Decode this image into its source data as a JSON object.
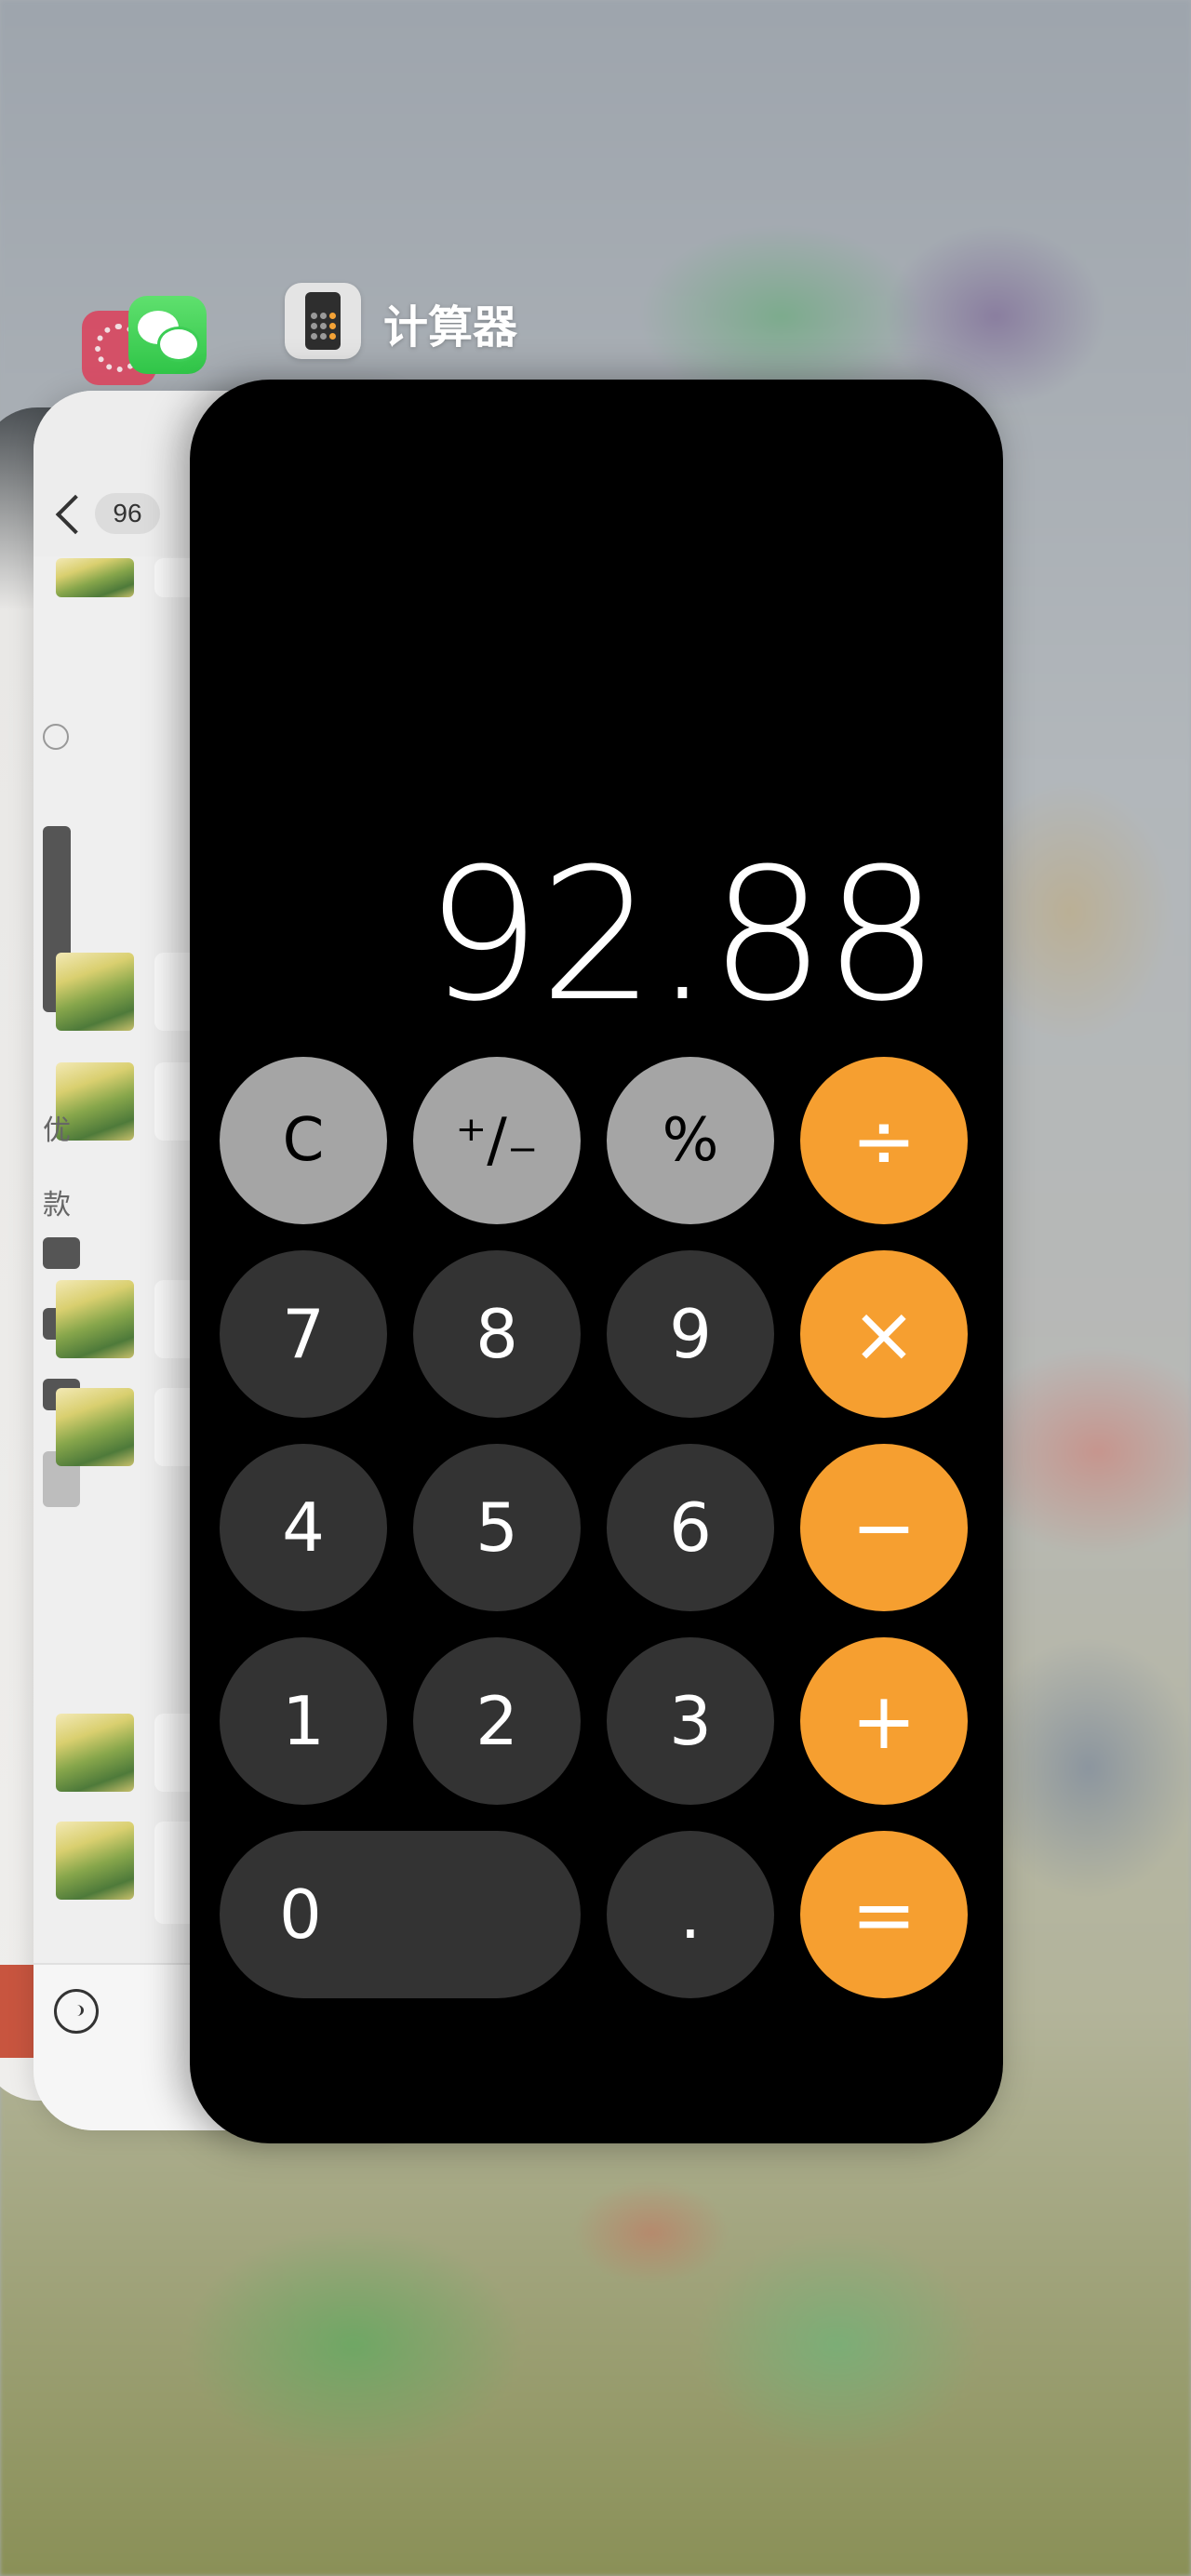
{
  "app_switcher": {
    "active_app_label": "计算器",
    "background_apps": [
      {
        "name": "WeChat",
        "icon": "wechat-icon"
      },
      {
        "name": "other-app",
        "icon": "red-app-icon"
      }
    ]
  },
  "wechat_card": {
    "unread_badge": "96",
    "side_text_1": "优",
    "side_text_2": "款"
  },
  "calculator": {
    "display": "92.88",
    "keys": [
      {
        "name": "clear-key",
        "label": "C",
        "kind": "fn"
      },
      {
        "name": "plus-minus-key",
        "label": "⁺∕₋",
        "kind": "fn"
      },
      {
        "name": "percent-key",
        "label": "%",
        "kind": "fn"
      },
      {
        "name": "divide-key",
        "label": "÷",
        "kind": "op"
      },
      {
        "name": "key-7",
        "label": "7",
        "kind": "num"
      },
      {
        "name": "key-8",
        "label": "8",
        "kind": "num"
      },
      {
        "name": "key-9",
        "label": "9",
        "kind": "num"
      },
      {
        "name": "multiply-key",
        "label": "×",
        "kind": "op"
      },
      {
        "name": "key-4",
        "label": "4",
        "kind": "num"
      },
      {
        "name": "key-5",
        "label": "5",
        "kind": "num"
      },
      {
        "name": "key-6",
        "label": "6",
        "kind": "num"
      },
      {
        "name": "minus-key",
        "label": "−",
        "kind": "op"
      },
      {
        "name": "key-1",
        "label": "1",
        "kind": "num"
      },
      {
        "name": "key-2",
        "label": "2",
        "kind": "num"
      },
      {
        "name": "key-3",
        "label": "3",
        "kind": "num"
      },
      {
        "name": "plus-key",
        "label": "+",
        "kind": "op"
      },
      {
        "name": "key-0",
        "label": "0",
        "kind": "num"
      },
      {
        "name": "decimal-key",
        "label": ".",
        "kind": "num"
      },
      {
        "name": "equals-key",
        "label": "=",
        "kind": "op"
      }
    ],
    "colors": {
      "operator": "#f69f30",
      "function": "#a5a5a5",
      "number": "#333333",
      "background": "#000000"
    }
  }
}
